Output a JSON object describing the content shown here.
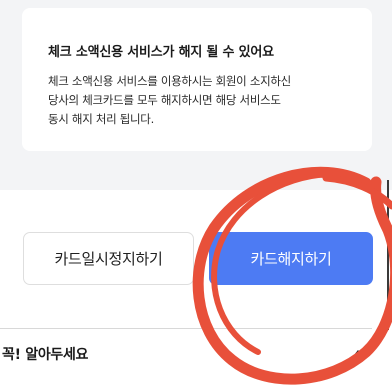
{
  "notice": {
    "title": "체크 소액신용 서비스가 해지 될 수 있어요",
    "lines": [
      "체크 소액신용 서비스를 이용하시는 회원이 소지하신",
      "당사의 체크카드를 모두 해지하시면 해당 서비스도",
      "동시 해지 처리 됩니다."
    ]
  },
  "buttons": {
    "suspend_label": "카드일시정지하기",
    "cancel_label": "카드해지하기"
  },
  "know_section": {
    "title": "꼭! 알아두세요",
    "caret_icon": "caret-up-icon"
  },
  "colors": {
    "accent": "#4d7bf3",
    "annotation": "#e8503a",
    "background_gray": "#f3f4f6"
  }
}
